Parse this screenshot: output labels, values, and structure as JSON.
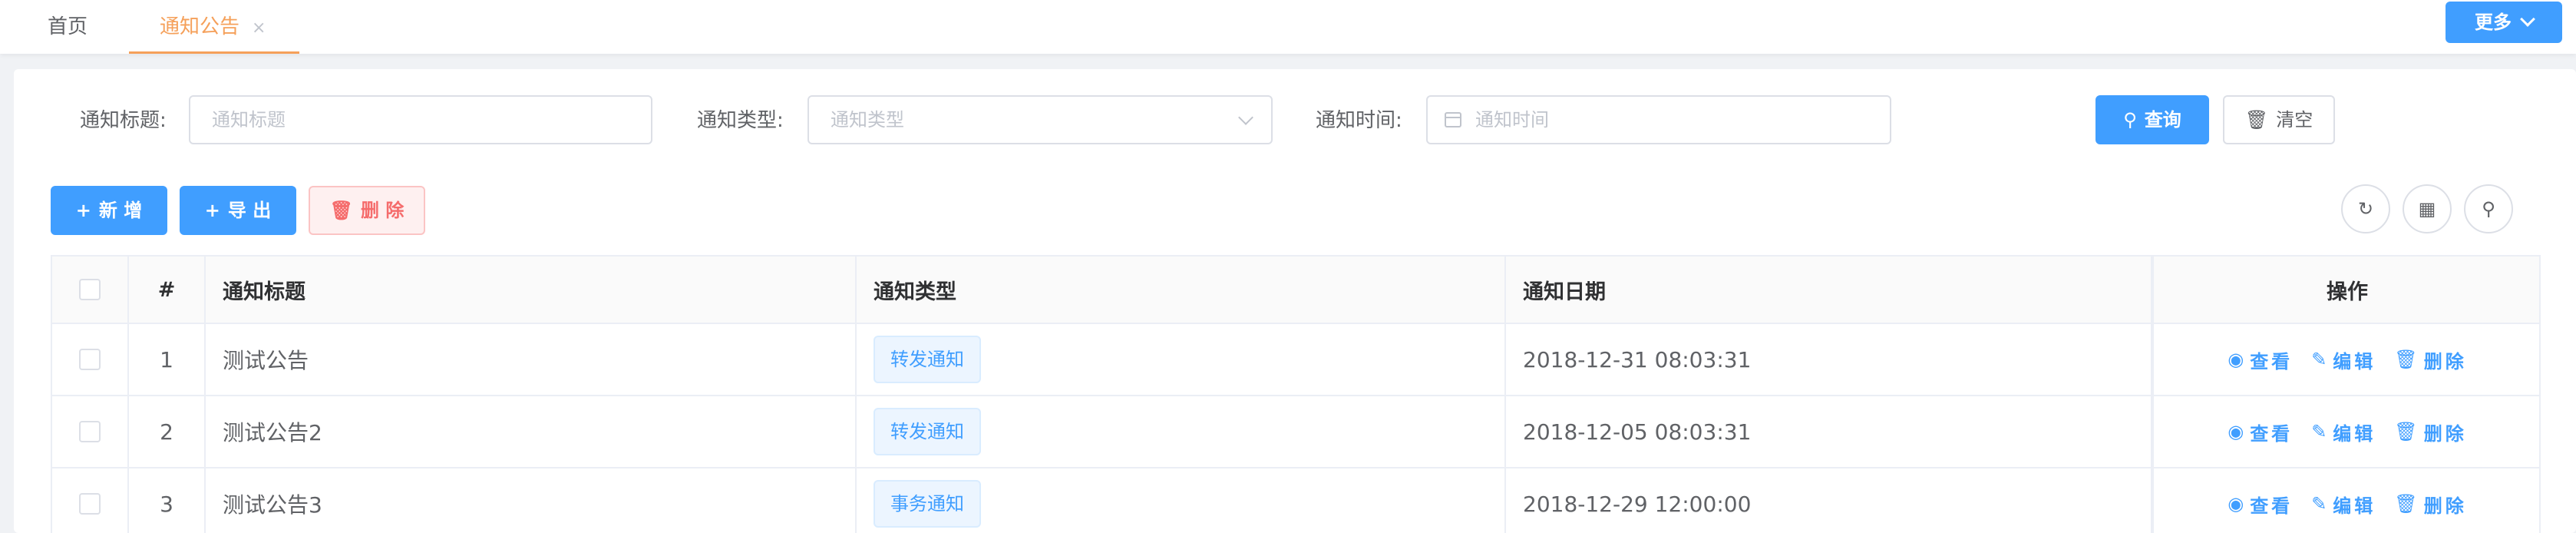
{
  "tabs": {
    "home": "首页",
    "notice": "通知公告",
    "close": "×",
    "more": "更多"
  },
  "search": {
    "title_label": "通知标题:",
    "title_placeholder": "通知标题",
    "type_label": "通知类型:",
    "type_placeholder": "通知类型",
    "time_label": "通知时间:",
    "time_placeholder": "通知时间",
    "query_label": "查询",
    "clear_label": "清空"
  },
  "toolbar": {
    "add_label": "新 增",
    "export_label": "导 出",
    "delete_label": "删 除"
  },
  "table": {
    "headers": {
      "index": "#",
      "title": "通知标题",
      "type": "通知类型",
      "date": "通知日期",
      "ops": "操作"
    },
    "rows": [
      {
        "index": "1",
        "title": "测试公告",
        "type": "转发通知",
        "date": "2018-12-31 08:03:31"
      },
      {
        "index": "2",
        "title": "测试公告2",
        "type": "转发通知",
        "date": "2018-12-05 08:03:31"
      },
      {
        "index": "3",
        "title": "测试公告3",
        "type": "事务通知",
        "date": "2018-12-29 12:00:00"
      }
    ],
    "ops": {
      "view": "查看",
      "edit": "编辑",
      "delete": "删除"
    }
  },
  "colors": {
    "primary": "#409eff",
    "danger": "#f56c6c",
    "tab_active": "#f5a05a"
  },
  "icons": {
    "search": "search-icon",
    "trash": "trash-icon",
    "plus": "plus-icon",
    "refresh": "refresh-icon",
    "grid": "grid-icon",
    "eye": "eye-icon",
    "edit": "edit-icon",
    "calendar": "calendar-icon",
    "chevron": "chevron-down-icon"
  }
}
